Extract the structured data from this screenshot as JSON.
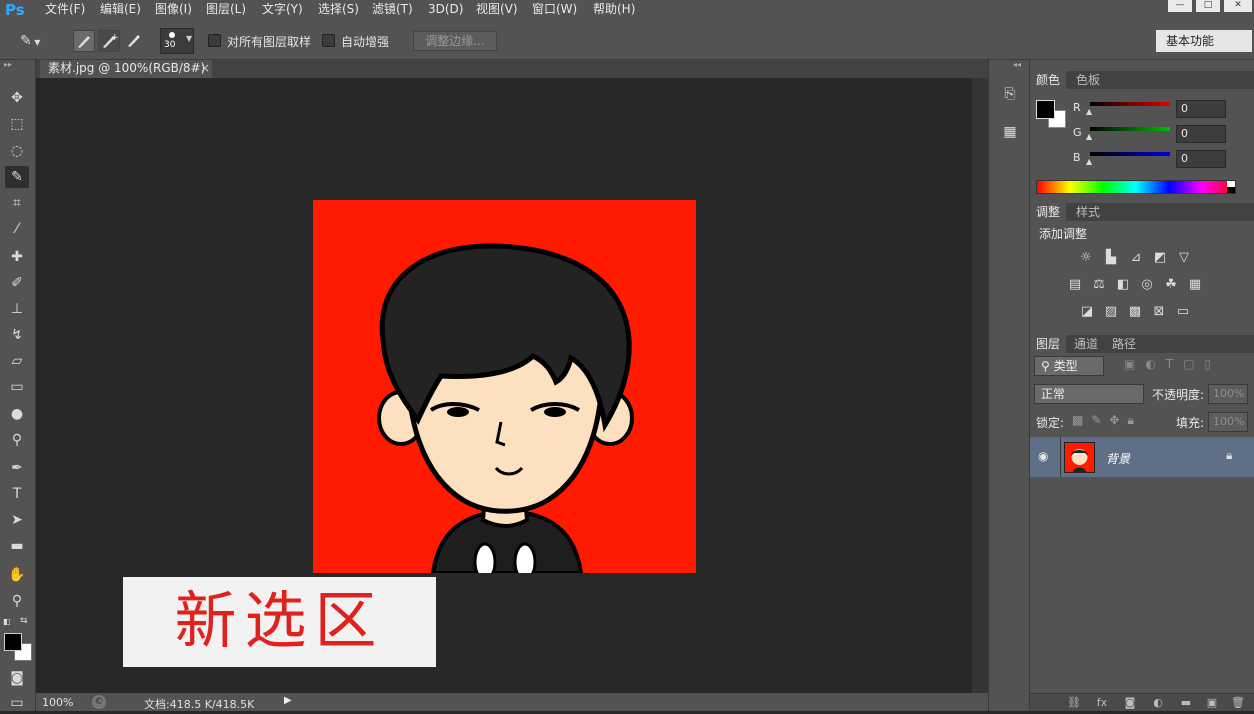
{
  "app": {
    "logo": "Ps"
  },
  "menu": [
    "文件(F)",
    "编辑(E)",
    "图像(I)",
    "图层(L)",
    "文字(Y)",
    "选择(S)",
    "滤镜(T)",
    "3D(D)",
    "视图(V)",
    "窗口(W)",
    "帮助(H)"
  ],
  "window_controls": {
    "minimize": "—",
    "maximize": "□",
    "close": "✕"
  },
  "options": {
    "brush_size": "30",
    "sample_all_layers": "对所有图层取样",
    "auto_enhance": "自动增强",
    "refine_edge": "调整边缘...",
    "workspace": "基本功能"
  },
  "document": {
    "tab_title": "素材.jpg @ 100%(RGB/8#)",
    "tab_close": "×",
    "zoom": "100%",
    "doc_size": "文档:418.5 K/418.5K"
  },
  "caption": "新选区",
  "color_panel": {
    "tabs": [
      "颜色",
      "色板"
    ],
    "channels": [
      {
        "label": "R",
        "value": "0",
        "color": "#e00000"
      },
      {
        "label": "G",
        "value": "0",
        "color": "#00b000"
      },
      {
        "label": "B",
        "value": "0",
        "color": "#0000e0"
      }
    ]
  },
  "adjust_panel": {
    "tabs": [
      "调整",
      "样式"
    ],
    "title": "添加调整"
  },
  "layers_panel": {
    "tabs": [
      "图层",
      "通道",
      "路径"
    ],
    "filter_kind": "类型",
    "blend_mode": "正常",
    "opacity_label": "不透明度:",
    "opacity_value": "100%",
    "lock_label": "锁定:",
    "fill_label": "填充:",
    "fill_value": "100%",
    "layers": [
      {
        "name": "背景",
        "visible": true,
        "locked": true
      }
    ]
  },
  "colors": {
    "canvas_bg": "#ff1a00",
    "accent": "#31a8ff",
    "caption_text": "#e0221e"
  }
}
